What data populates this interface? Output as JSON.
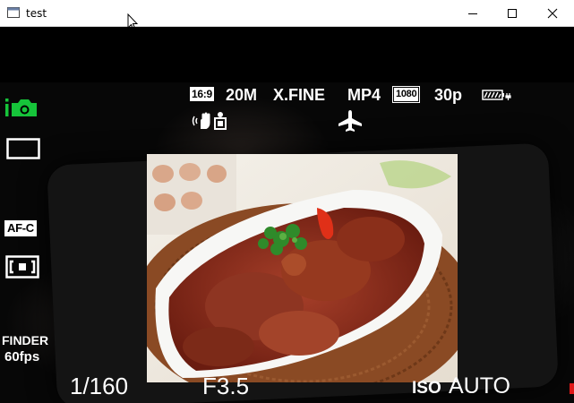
{
  "window": {
    "title": "test",
    "controls": [
      "minimize",
      "maximize",
      "close"
    ]
  },
  "camera_osd": {
    "mode_icon": "intelligent-auto-camera-icon",
    "aspect_ratio": "16:9",
    "image_size": "20M",
    "quality": "X.FINE",
    "movie_format": "MP4",
    "movie_resolution": "1080",
    "frame_rate": "30p",
    "battery_icon": "battery-charging-icon",
    "steadyshot_icon": "steadyshot-icon",
    "scene_icon": "scene-recognition-icon",
    "airplane_icon": "airplane-mode-icon",
    "drive_mode_icon": "single-shot-frame-icon",
    "focus_mode": "AF-C",
    "focus_area_icon": "focus-area-icon",
    "finder_label": "FINDER",
    "finder_fps": "60fps",
    "shutter_speed": "1/160",
    "aperture": "F3.5",
    "iso_label": "ISO",
    "iso_value": "AUTO"
  },
  "colors": {
    "osd": "#ffffff",
    "mode_icon": "#16c43a",
    "iso_indicator": "#e01818"
  }
}
